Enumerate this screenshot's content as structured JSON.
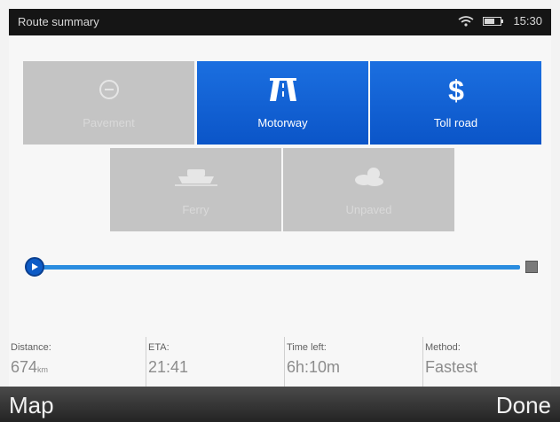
{
  "status_bar": {
    "title": "Route summary",
    "time": "15:30",
    "icons": [
      "wifi-icon",
      "battery-icon"
    ]
  },
  "route_options": [
    {
      "label": "Pavement",
      "icon": "minus-circle-icon",
      "active": false
    },
    {
      "label": "Motorway",
      "icon": "motorway-icon",
      "active": true
    },
    {
      "label": "Toll road",
      "icon": "dollar-icon",
      "active": true
    },
    {
      "label": "Ferry",
      "icon": "ferry-icon",
      "active": false
    },
    {
      "label": "Unpaved",
      "icon": "cloud-sun-icon",
      "active": false
    }
  ],
  "route_progress": {
    "start_icon": "play-icon",
    "end_icon": "flag-icon"
  },
  "stats": {
    "distance": {
      "caption": "Distance:",
      "value": "674",
      "unit": "km"
    },
    "eta": {
      "caption": "ETA:",
      "value": "21:41"
    },
    "time_left": {
      "caption": "Time left:",
      "value": "6h:10m"
    },
    "method": {
      "caption": "Method:",
      "value": "Fastest"
    }
  },
  "bottom_bar": {
    "map_label": "Map",
    "done_label": "Done"
  },
  "colors": {
    "active_tile": "#1b6fe0",
    "inactive_tile": "#c4c4c4",
    "route_line": "#2a8de0"
  }
}
